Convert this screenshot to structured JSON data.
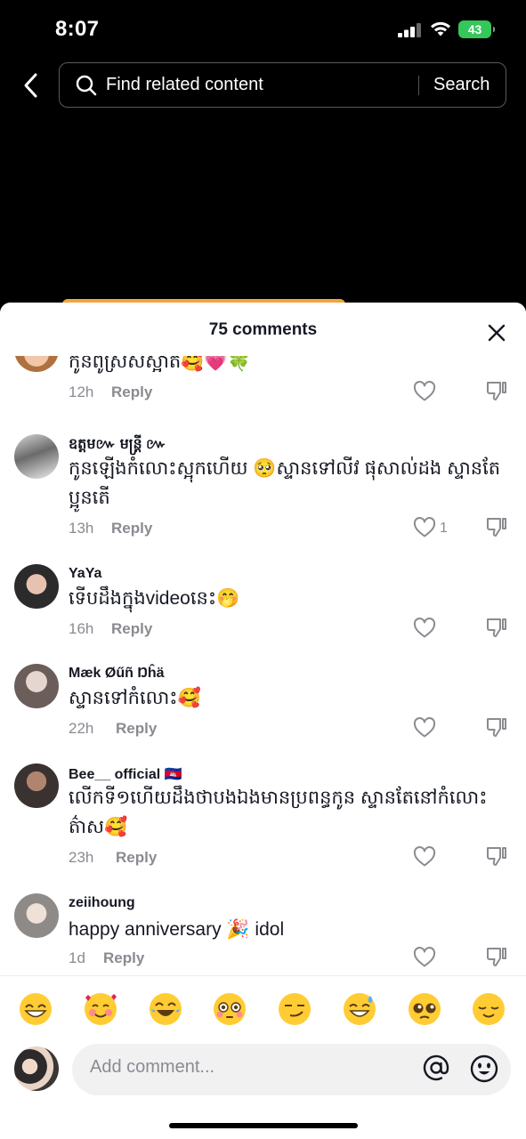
{
  "status_bar": {
    "time": "8:07",
    "battery": "43"
  },
  "search": {
    "placeholder": "Find related content",
    "button_label": "Search"
  },
  "comments_header": {
    "count_label": "75 comments"
  },
  "comments": [
    {
      "name": "",
      "text": "កូនពូស្រស់ស្អាត🥰💗🍀",
      "time": "12h",
      "reply": "Reply",
      "likes": ""
    },
    {
      "name": "ឧត្តម៚ មន្ត្រី ៚",
      "text": "កូនឡើងកំលោះស្អុកហើយ 🥺ស្ទានទៅលីវ ផុសាល់ដង ស្ទានតែប្អូនតើ",
      "time": "13h",
      "reply": "Reply",
      "likes": "1"
    },
    {
      "name": "YaYa",
      "text": "ទើបដឹងក្នុងvideoនេះ🤭",
      "time": "16h",
      "reply": "Reply",
      "likes": ""
    },
    {
      "name": "Mæk Øűñ Ŋĥä",
      "text": "ស្ទានទៅកំលោះ🥰",
      "time": "22h",
      "reply": "Reply",
      "likes": ""
    },
    {
      "name": "Bee__ official 🇰🇭",
      "text": "លើកទី១ហើយដឹងថាបងឯងមានប្រពន្ធកូន ស្ទានតែនៅកំលោះ ត៌ាស🥰",
      "time": "23h",
      "reply": "Reply",
      "likes": ""
    },
    {
      "name": "zeiihoung",
      "text": "happy anniversary 🎉 idol",
      "time": "1d",
      "reply": "Reply",
      "likes": ""
    }
  ],
  "quick_emojis": [
    "😁",
    "🥰",
    "😂",
    "😳",
    "😏",
    "😅",
    "🥺",
    "😌"
  ],
  "composer": {
    "placeholder": "Add comment..."
  },
  "icons": {
    "back": "chevron-left-icon",
    "search": "search-icon",
    "close": "close-icon",
    "like": "heart-outline-icon",
    "dislike": "thumbs-down-icon",
    "mention": "at-icon",
    "emoji": "smiley-icon"
  },
  "colors": {
    "battery": "#34c759",
    "text_primary": "#161823",
    "text_secondary": "#8a8b91",
    "input_bg": "#f1f1f2"
  }
}
